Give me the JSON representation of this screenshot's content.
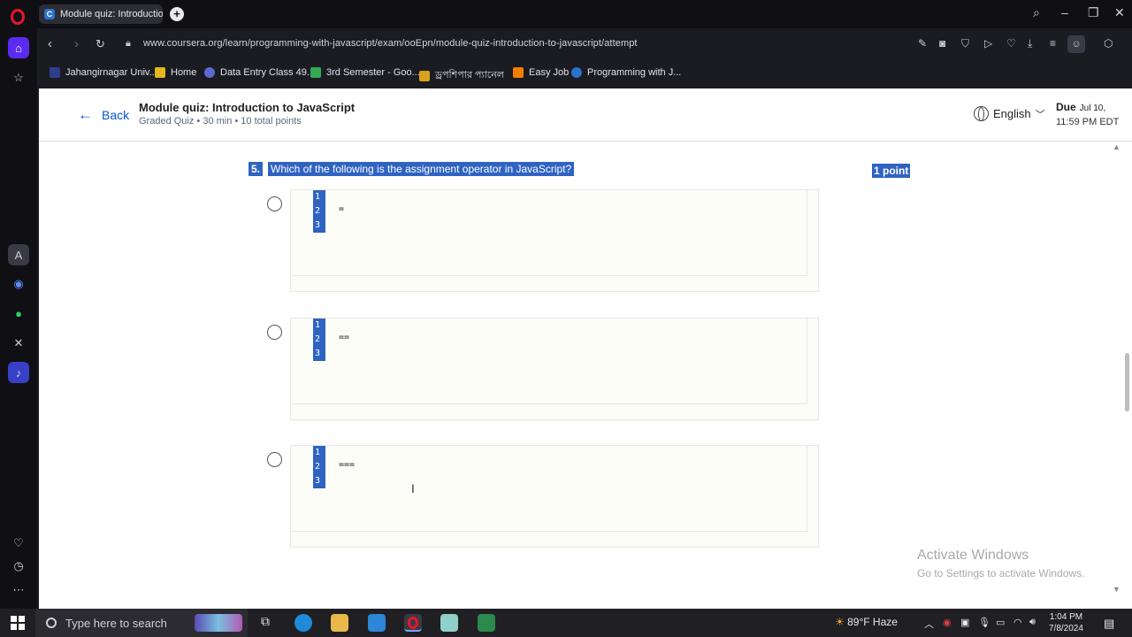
{
  "browser": {
    "tab_title": "Module quiz: Introduction",
    "tab_favicon": "C",
    "url": "www.coursera.org/learn/programming-with-javascript/exam/ooEpn/module-quiz-introduction-to-javascript/attempt",
    "bookmarks": [
      {
        "label": "Jahangirnagar Univ...",
        "icon": "university-icon",
        "color": "#2c3e8c"
      },
      {
        "label": "Home",
        "icon": "home-icon",
        "color": "#e0b81e"
      },
      {
        "label": "Data Entry Class 49...",
        "icon": "globe-icon",
        "color": "#5a6acf"
      },
      {
        "label": "3rd Semester - Goo...",
        "icon": "drive-icon",
        "color": "#34a853"
      },
      {
        "label": "ড্রপশিপার প্যানেল",
        "icon": "drop-icon",
        "color": "#d9a21b"
      },
      {
        "label": "Easy Job",
        "icon": "blogger-icon",
        "color": "#f57d00"
      },
      {
        "label": "Programming with J...",
        "icon": "coursera-icon",
        "color": "#2a73cc"
      }
    ]
  },
  "header": {
    "back_label": "Back",
    "quiz_title": "Module quiz: Introduction to JavaScript",
    "quiz_meta": "Graded Quiz • 30 min • 10 total points",
    "language": "English",
    "due_label": "Due",
    "due_date": "Jul 10,",
    "due_time": "11:59 PM EDT"
  },
  "question": {
    "number": "5.",
    "text": "Which of the following is the assignment operator in JavaScript?",
    "points": "1 point",
    "options": [
      {
        "lines": [
          "1",
          "2",
          "3"
        ],
        "code": "="
      },
      {
        "lines": [
          "1",
          "2",
          "3"
        ],
        "code": "=="
      },
      {
        "lines": [
          "1",
          "2",
          "3"
        ],
        "code": "==="
      }
    ]
  },
  "watermark": {
    "title": "Activate Windows",
    "subtitle": "Go to Settings to activate Windows."
  },
  "taskbar": {
    "search_placeholder": "Type here to search",
    "weather": "89°F  Haze",
    "time": "1:04 PM",
    "date": "7/8/2024"
  }
}
